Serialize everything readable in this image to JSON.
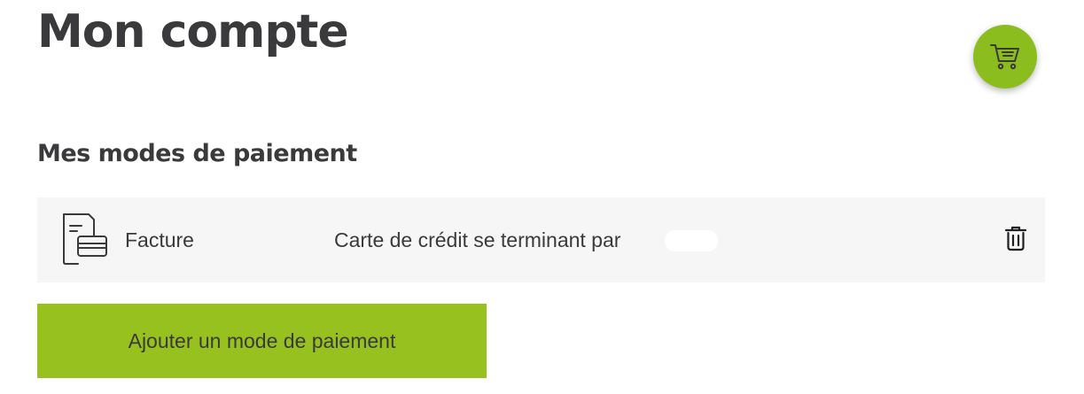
{
  "header": {
    "title": "Mon compte",
    "cart_icon": "shopping-cart-icon",
    "cart_color": "#8cbd1f"
  },
  "payment_methods": {
    "section_title": "Mes modes de paiement",
    "items": [
      {
        "icon": "invoice-card-icon",
        "name": "Facture",
        "description": "Carte de crédit se terminant par",
        "delete_icon": "trash-icon"
      }
    ],
    "add_button_label": "Ajouter un mode de paiement",
    "add_button_color": "#96c11f"
  }
}
